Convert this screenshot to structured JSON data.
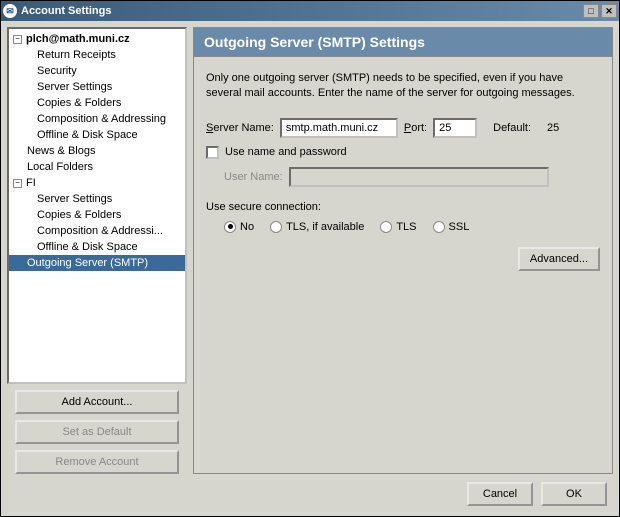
{
  "titlebar": {
    "title": "Account Settings"
  },
  "tree": {
    "acct1": {
      "name": "plch@math.muni.cz",
      "items": [
        "Return Receipts",
        "Security",
        "Server Settings",
        "Copies & Folders",
        "Composition & Addressing",
        "Offline & Disk Space"
      ]
    },
    "news": "News & Blogs",
    "local": "Local Folders",
    "acct2": {
      "name": "FI",
      "items": [
        "Server Settings",
        "Copies & Folders",
        "Composition & Addressi...",
        "Offline & Disk Space"
      ]
    },
    "smtp": "Outgoing Server (SMTP)"
  },
  "sidebar_buttons": {
    "add": "Add Account...",
    "default": "Set as Default",
    "remove": "Remove Account"
  },
  "panel": {
    "title": "Outgoing Server (SMTP) Settings",
    "description": "Only one outgoing server (SMTP) needs to be specified, even if you have several mail accounts. Enter the name of the server for outgoing messages.",
    "server_label": "Server Name:",
    "server_value": "smtp.math.muni.cz",
    "port_label": "Port:",
    "port_value": "25",
    "default_label": "Default:",
    "default_value": "25",
    "auth_checkbox": "Use name and password",
    "username_label": "User Name:",
    "username_value": "",
    "secure_label": "Use secure connection:",
    "radios": {
      "no": "No",
      "tls_avail": "TLS, if available",
      "tls": "TLS",
      "ssl": "SSL"
    },
    "advanced": "Advanced..."
  },
  "footer": {
    "cancel": "Cancel",
    "ok": "OK"
  }
}
